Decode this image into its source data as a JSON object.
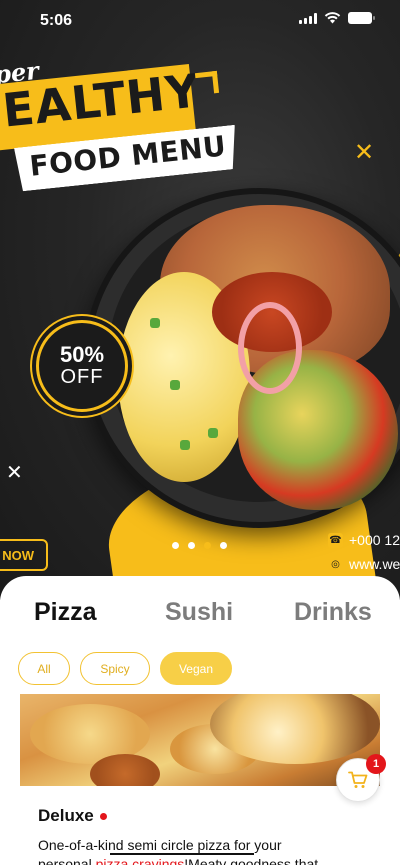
{
  "status_bar": {
    "time": "5:06"
  },
  "banner": {
    "script_word": "per",
    "headline": "EALTHY",
    "subheadline": "FOOD MENU",
    "discount_percent": "50%",
    "discount_off": "OFF",
    "order_label": "NOW",
    "phone": "+000 12",
    "website": "www.we",
    "carousel": {
      "slide_count": 4,
      "active_index": 2
    }
  },
  "menu": {
    "tabs": [
      {
        "label": "Pizza",
        "active": true
      },
      {
        "label": "Sushi",
        "active": false
      },
      {
        "label": "Drinks",
        "active": false
      }
    ],
    "filters": [
      {
        "label": "All",
        "active": false
      },
      {
        "label": "Spicy",
        "active": false
      },
      {
        "label": "Vegan",
        "active": true
      }
    ],
    "item": {
      "name": "Deluxe",
      "description_line1": "One-of-a-kind semi circle pizza for your",
      "description_line2_a": "personal ",
      "description_line2_red": "pizza cravings",
      "description_line2_b": "!Meaty goodness that"
    }
  },
  "cart": {
    "count": "1"
  },
  "colors": {
    "accent_yellow": "#f7bd1a",
    "badge_red": "#e3161b",
    "dark_bg": "#262626"
  },
  "icons": [
    "wifi-icon",
    "battery-icon",
    "signal-icon",
    "phone-icon",
    "globe-icon",
    "cart-icon",
    "close-x-icon"
  ]
}
